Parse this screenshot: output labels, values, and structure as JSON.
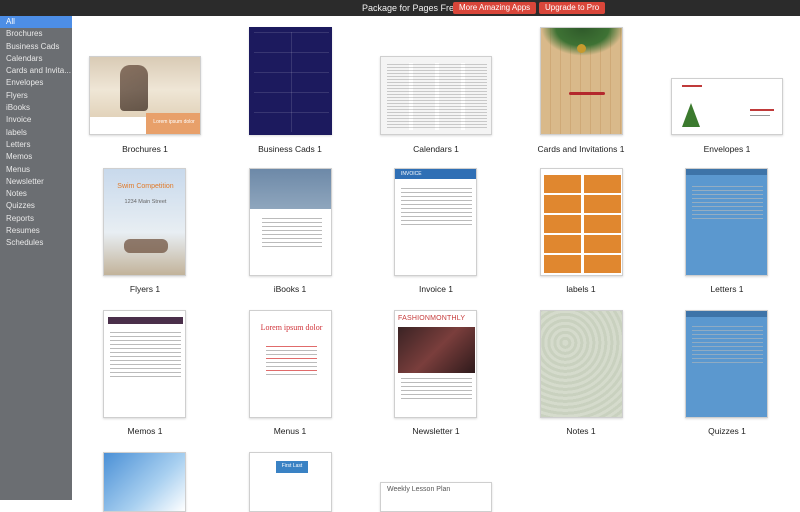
{
  "topbar": {
    "title": "Package for Pages Free",
    "more_apps": "More Amazing Apps",
    "upgrade": "Upgrade to Pro"
  },
  "sidebar": {
    "items": [
      {
        "label": "All",
        "active": true
      },
      {
        "label": "Brochures"
      },
      {
        "label": "Business Cads"
      },
      {
        "label": "Calendars"
      },
      {
        "label": "Cards and Invita..."
      },
      {
        "label": "Envelopes"
      },
      {
        "label": "Flyers"
      },
      {
        "label": "iBooks"
      },
      {
        "label": "Invoice"
      },
      {
        "label": "labels"
      },
      {
        "label": "Letters"
      },
      {
        "label": "Memos"
      },
      {
        "label": "Menus"
      },
      {
        "label": "Newsletter"
      },
      {
        "label": "Notes"
      },
      {
        "label": "Quizzes"
      },
      {
        "label": "Reports"
      },
      {
        "label": "Resumes"
      },
      {
        "label": "Schedules"
      }
    ]
  },
  "templates": [
    {
      "caption": "Brochures 1"
    },
    {
      "caption": "Business Cads 1"
    },
    {
      "caption": "Calendars 1"
    },
    {
      "caption": "Cards and Invitations 1"
    },
    {
      "caption": "Envelopes 1"
    },
    {
      "caption": "Flyers 1"
    },
    {
      "caption": "iBooks 1"
    },
    {
      "caption": "Invoice 1"
    },
    {
      "caption": "labels 1"
    },
    {
      "caption": "Letters 1"
    },
    {
      "caption": "Memos 1"
    },
    {
      "caption": "Menus 1"
    },
    {
      "caption": "Newsletter 1"
    },
    {
      "caption": "Notes 1"
    },
    {
      "caption": "Quizzes 1"
    }
  ],
  "thumb_text": {
    "brochure_tag": "Lorem ipsum dolor",
    "flyer_title": "Swim Competition",
    "flyer_sub": "1234 Main Street",
    "invoice_head": "INVOICE",
    "menus_title": "Lorem ipsum dolor",
    "newsletter_title": "FASHIONMONTHLY",
    "weekly_plan": "Weekly Lesson Plan",
    "first_last": "First Last"
  },
  "colors": {
    "accent": "#4d8ee6",
    "button_red": "#d9463a",
    "sidebar_bg": "#6b6e72",
    "topbar_bg": "#2b2b2b"
  }
}
